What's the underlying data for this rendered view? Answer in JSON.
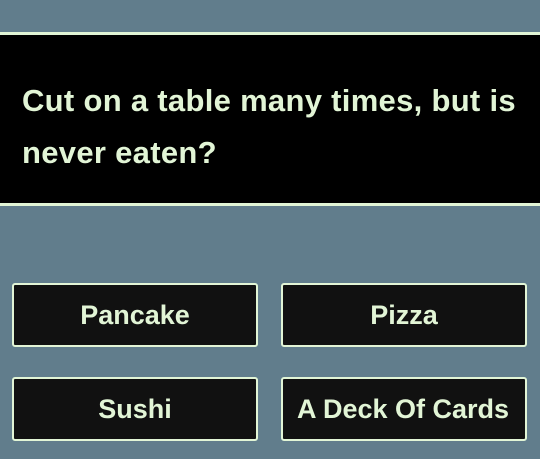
{
  "question": {
    "text": "Cut on a table many times, but is never eaten?"
  },
  "answers": [
    {
      "label": "Pancake"
    },
    {
      "label": "Pizza"
    },
    {
      "label": "Sushi"
    },
    {
      "label": "A Deck Of Cards"
    }
  ],
  "colors": {
    "background": "#617d8c",
    "panel": "#000000",
    "button": "#111111",
    "text": "#e2f5d6",
    "border": "#e2f5d6"
  }
}
